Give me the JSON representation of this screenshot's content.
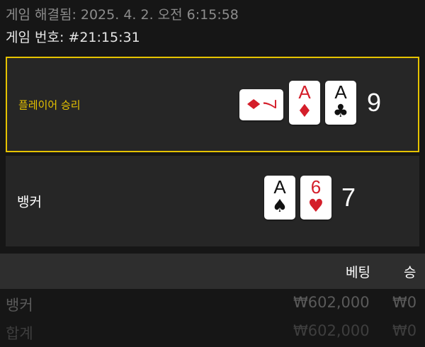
{
  "header": {
    "resolved": "게임 해결됨: 2025. 4. 2. 오전 6:15:58",
    "game_number": "게임 번호: #21:15:31"
  },
  "player": {
    "label": "플레이어 승리",
    "total": "9",
    "cards": [
      {
        "rank": "7",
        "suit": "♦",
        "color": "red",
        "orientation": "sideways"
      },
      {
        "rank": "A",
        "suit": "♦",
        "color": "red",
        "orientation": "upright"
      },
      {
        "rank": "A",
        "suit": "♣",
        "color": "black",
        "orientation": "upright"
      }
    ]
  },
  "banker": {
    "label": "뱅커",
    "total": "7",
    "cards": [
      {
        "rank": "A",
        "suit": "♠",
        "color": "black",
        "orientation": "upright"
      },
      {
        "rank": "6",
        "suit": "♥",
        "color": "red",
        "orientation": "upright"
      }
    ]
  },
  "bets": {
    "headers": {
      "bet": "베팅",
      "win": "승"
    },
    "rows": [
      {
        "name": "뱅커",
        "bet": "₩602,000",
        "win": "₩0"
      },
      {
        "name": "합계",
        "bet": "₩602,000",
        "win": "₩0"
      }
    ]
  },
  "colors": {
    "accent_gold": "#e6c300",
    "card_red": "#d41e2a",
    "background": "#161616",
    "panel": "#262626"
  }
}
